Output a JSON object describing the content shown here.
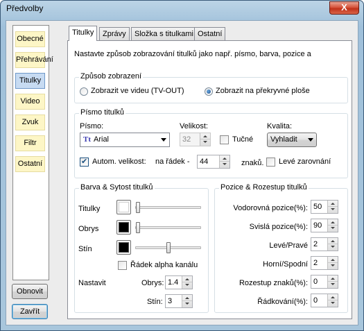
{
  "window": {
    "title": "Předvolby",
    "close_glyph": "X"
  },
  "sidebar": {
    "items": [
      {
        "label": "Obecné"
      },
      {
        "label": "Přehrávání"
      },
      {
        "label": "Titulky"
      },
      {
        "label": "Video"
      },
      {
        "label": "Zvuk"
      },
      {
        "label": "Filtr"
      },
      {
        "label": "Ostatní"
      }
    ],
    "active": "Titulky"
  },
  "buttons": {
    "reset": "Obnovit",
    "close": "Zavřít"
  },
  "tabs": [
    {
      "label": "Titulky"
    },
    {
      "label": "Zprávy"
    },
    {
      "label": "Složka s titulkami"
    },
    {
      "label": "Ostatní"
    }
  ],
  "intro": "Nastavte způsob zobrazování titulků jako např. písmo, barva, pozice a",
  "display_mode": {
    "legend": "Způsob zobrazení",
    "option_video": "Zobrazit ve videu (TV-OUT)",
    "option_overlay": "Zobrazit na překryvné ploše",
    "selected": "option_overlay"
  },
  "font": {
    "legend": "Písmo titulků",
    "font_label": "Písmo:",
    "font_value": "Arial",
    "font_icon": "Tt",
    "size_label": "Velikost:",
    "size_value": "32",
    "bold_label": "Tučné",
    "bold_checked": false,
    "quality_label": "Kvalita:",
    "quality_value": "Vyhladit",
    "auto_size_label": "Autom. velikost:",
    "auto_size_checked": true,
    "per_line_label": "na řádek -",
    "per_line_value": "44",
    "chars_label": "znaků.",
    "left_align_label": "Levé zarovnání",
    "left_align_checked": false
  },
  "colors": {
    "legend": "Barva & Sytost titulků",
    "rows": [
      {
        "label": "Titulky",
        "color": "#ffffff",
        "level": 0.0
      },
      {
        "label": "Obrys",
        "color": "#000000",
        "level": 0.0
      },
      {
        "label": "Stín",
        "color": "#000000",
        "level": 0.5
      }
    ],
    "alpha_label": "Řádek alpha kanálu",
    "alpha_checked": false,
    "set_label": "Nastavit",
    "outline_label": "Obrys:",
    "outline_value": "1.4",
    "shadow_label": "Stín:",
    "shadow_value": "3"
  },
  "position": {
    "legend": "Pozice & Rozestup titulků",
    "fields": [
      {
        "label": "Vodorovná pozice(%):",
        "value": "50"
      },
      {
        "label": "Svislá pozice(%):",
        "value": "90"
      },
      {
        "label": "Levé/Pravé",
        "value": "2"
      },
      {
        "label": "Horní/Spodní",
        "value": "2"
      },
      {
        "label": "Rozestup znaků(%):",
        "value": "0"
      },
      {
        "label": "Řádkování(%):",
        "value": "0"
      }
    ]
  }
}
